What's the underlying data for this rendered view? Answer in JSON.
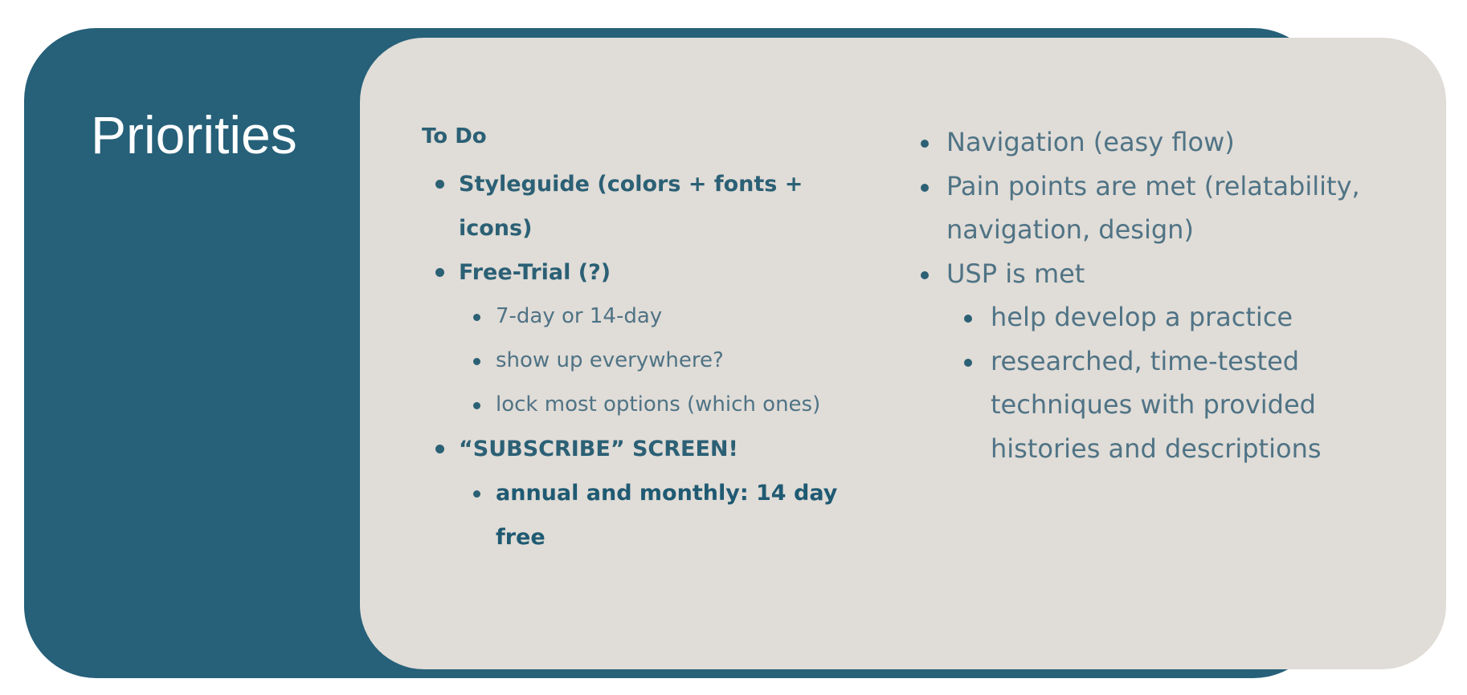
{
  "slide": {
    "title": "Priorities",
    "colors": {
      "frame": "#266079",
      "card": "#e0dcd7",
      "text": "#2b6075"
    }
  },
  "todo": {
    "heading": "To Do",
    "items": [
      {
        "label": "Styleguide (colors + fonts + icons)",
        "subitems": []
      },
      {
        "label": "Free-Trial (?)",
        "subitems": [
          "7-day or 14-day",
          "show up everywhere?",
          "lock most options (which ones)"
        ]
      },
      {
        "label": "“SUBSCRIBE” SCREEN!",
        "subitems": [
          "annual and monthly: 14 day free"
        ]
      }
    ]
  },
  "goals": {
    "items": [
      {
        "label": "Navigation (easy flow)",
        "subitems": []
      },
      {
        "label": "Pain points are met (relatability, navigation, design)",
        "subitems": []
      },
      {
        "label": "USP is met",
        "subitems": [
          "help develop a practice",
          "researched, time-tested techniques with provided histories and descriptions"
        ]
      }
    ]
  }
}
